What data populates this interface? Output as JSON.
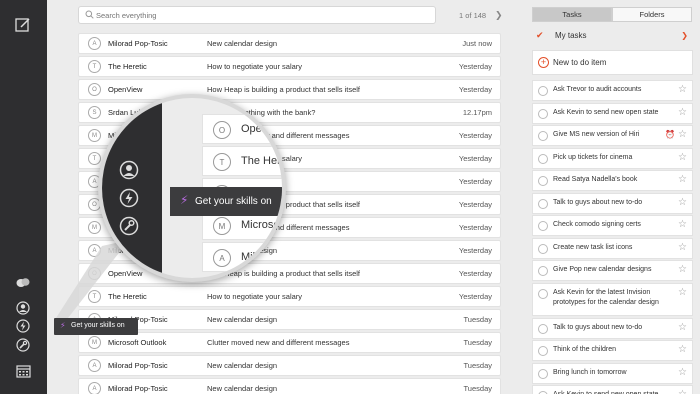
{
  "search": {
    "placeholder": "Search everything"
  },
  "pager": {
    "text": "1 of 148",
    "next_icon": "chevron-right-icon"
  },
  "mails": [
    {
      "avatar": "A",
      "sender": "Milorad Pop-Tosic",
      "subject": "New calendar design",
      "time": "Just now"
    },
    {
      "avatar": "T",
      "sender": "The Heretic",
      "subject": "How to negotiate your salary",
      "time": "Yesterday"
    },
    {
      "avatar": "O",
      "sender": "OpenView",
      "subject": "How Heap is building a product that sells itself",
      "time": "Yesterday"
    },
    {
      "avatar": "S",
      "sender": "Srdan Lukovic",
      "subject": "Check something with the bank?",
      "time": "12.17pm"
    },
    {
      "avatar": "M",
      "sender": "Microsoft Outlook",
      "subject": "Clutter moved new and different messages",
      "time": "Yesterday"
    },
    {
      "avatar": "T",
      "sender": "The Heretic",
      "subject": "How to negotiate your salary",
      "time": "Yesterday"
    },
    {
      "avatar": "A",
      "sender": "Milorad Pop-Tosic",
      "subject": "New calendar design",
      "time": "Yesterday"
    },
    {
      "avatar": "O",
      "sender": "OpenView",
      "subject": "How Heap is building a product that sells itself",
      "time": "Yesterday"
    },
    {
      "avatar": "M",
      "sender": "Microsoft Outlook",
      "subject": "Clutter moved new and different messages",
      "time": "Yesterday"
    },
    {
      "avatar": "A",
      "sender": "Milorad Pop-Tosic",
      "subject": "New calendar design",
      "time": "Yesterday"
    },
    {
      "avatar": "O",
      "sender": "OpenView",
      "subject": "How Heap is building a product that sells itself",
      "time": "Yesterday"
    },
    {
      "avatar": "T",
      "sender": "The Heretic",
      "subject": "How to negotiate your salary",
      "time": "Yesterday"
    },
    {
      "avatar": "A",
      "sender": "Milorad Pop-Tosic",
      "subject": "New calendar design",
      "time": "Tuesday"
    },
    {
      "avatar": "M",
      "sender": "Microsoft Outlook",
      "subject": "Clutter moved new and different messages",
      "time": "Tuesday"
    },
    {
      "avatar": "A",
      "sender": "Milorad Pop-Tosic",
      "subject": "New calendar design",
      "time": "Tuesday"
    },
    {
      "avatar": "A",
      "sender": "Milorad Pop-Tosic",
      "subject": "New calendar design",
      "time": "Tuesday"
    }
  ],
  "tasks": {
    "tab_tasks": "Tasks",
    "tab_folders": "Folders",
    "list_title": "My tasks",
    "new_todo": "New to do item",
    "items": [
      {
        "label": "Ask Trevor to audit accounts"
      },
      {
        "label": "Ask Kevin to send new open state"
      },
      {
        "label": "Give MS new version of Hiri"
      },
      {
        "label": "Pick up tickets for cinema"
      },
      {
        "label": "Read Satya Nadella's book"
      },
      {
        "label": "Talk to guys about new to-do"
      },
      {
        "label": "Check comodo signing certs"
      },
      {
        "label": "Create new task list icons"
      },
      {
        "label": "Give Pop new calendar designs"
      },
      {
        "label": "Ask Kevin for the latest Invision prototypes for the calendar design"
      },
      {
        "label": "Talk to guys about new to-do"
      },
      {
        "label": "Think of the children"
      },
      {
        "label": "Bring lunch in tomorrow"
      },
      {
        "label": "Ask Kevin to send new open state"
      }
    ]
  },
  "tooltip": {
    "text": "Get your skills on"
  },
  "magnifier": {
    "rows": [
      {
        "avatar": "O",
        "sender": "OpenView"
      },
      {
        "avatar": "T",
        "sender": "The Heretic"
      },
      {
        "avatar": "A",
        "sender": "Milorad Pop"
      },
      {
        "avatar": "M",
        "sender": "Microsoft"
      },
      {
        "avatar": "A",
        "sender": "Milorad"
      }
    ]
  },
  "colors": {
    "accent": "#e3502a",
    "rail": "#2e2e30",
    "bolt": "#b86be0"
  }
}
